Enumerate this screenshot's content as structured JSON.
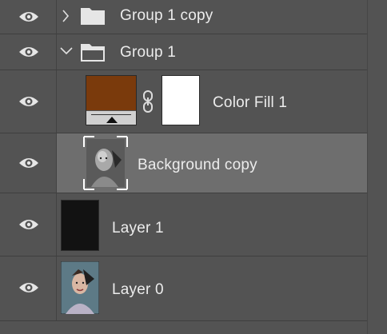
{
  "layers": [
    {
      "kind": "group",
      "name": "Group 1 copy",
      "expanded": false,
      "visible": true
    },
    {
      "kind": "group",
      "name": "Group 1",
      "expanded": true,
      "visible": true
    },
    {
      "kind": "fill",
      "name": "Color Fill 1",
      "fill_color": "#7a3a0c",
      "mask_color": "#ffffff",
      "linked": true,
      "visible": true
    },
    {
      "kind": "pixel",
      "name": "Background copy",
      "selected": true,
      "visible": true
    },
    {
      "kind": "pixel",
      "name": "Layer 1",
      "visible": true
    },
    {
      "kind": "pixel",
      "name": "Layer 0",
      "visible": true
    }
  ],
  "colors": {
    "panel_bg": "#535353",
    "selected_bg": "#6e6e6e",
    "divider": "#3f3f3f",
    "text": "#ececec",
    "icon": "#e6e6e6"
  }
}
